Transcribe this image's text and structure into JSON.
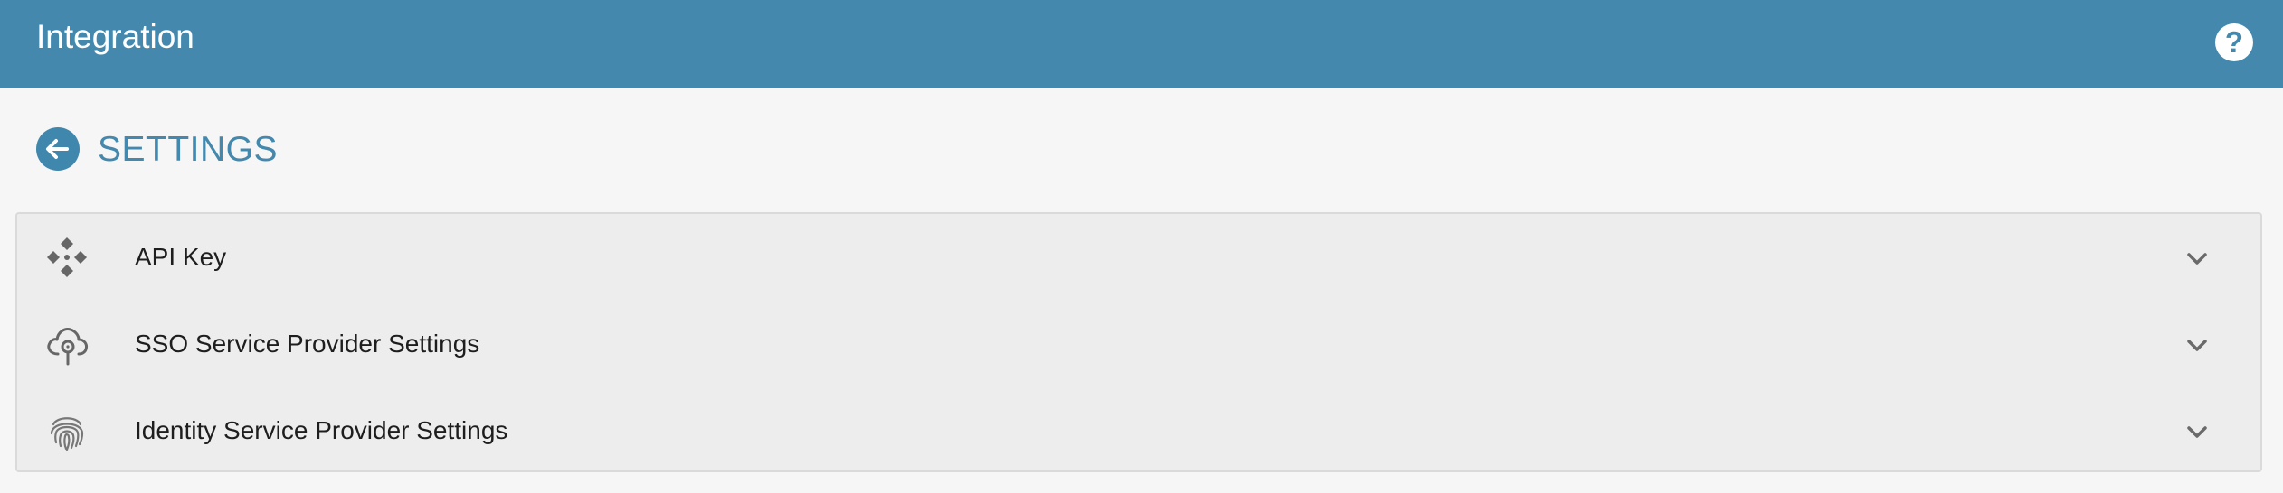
{
  "header": {
    "title": "Integration",
    "help_glyph": "?",
    "background_color": "#4489ad"
  },
  "page": {
    "title": "SETTINGS",
    "back_icon": "arrow-left-icon",
    "accent_color": "#4489ad"
  },
  "sections": [
    {
      "label": "API Key",
      "icon": "api-key-icon",
      "expanded": false
    },
    {
      "label": "SSO Service Provider Settings",
      "icon": "cloud-key-icon",
      "expanded": false
    },
    {
      "label": "Identity Service Provider Settings",
      "icon": "fingerprint-icon",
      "expanded": false
    }
  ]
}
